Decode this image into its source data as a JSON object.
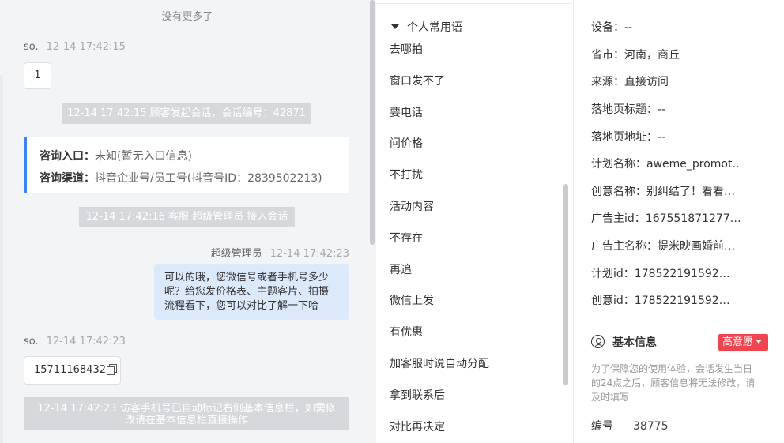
{
  "chat": {
    "no_more": "没有更多了",
    "msg1": {
      "sender": "so.",
      "time": "12-14 17:42:15",
      "text": "1"
    },
    "sys1": "12-14 17:42:15 顾客发起会话，会话编号：42871",
    "card": {
      "entry_label": "咨询入口：",
      "entry_value": "未知(暂无入口信息)",
      "channel_label": "咨询渠道：",
      "channel_value": "抖音企业号/员工号(抖音号ID：2839502213)"
    },
    "sys2": "12-14 17:42:16 客服 超级管理员 接入会话",
    "msg2": {
      "sender": "超级管理员",
      "time": "12-14 17:42:23",
      "line1": "可以的哦，您微信号或者手机号多少",
      "line2": "呢？给您发价格表、主题客片、拍摄",
      "line3": "流程看下，您可以对比了解一下哈"
    },
    "msg3": {
      "sender": "so.",
      "time": "12-14 17:42:23",
      "text": "15711168432",
      "icon": "copy-icon"
    },
    "sys3_line1": "12-14 17:42:23 访客手机号已自动标记右侧基本信息栏，如需修",
    "sys3_line2": "改请在基本信息栏直接操作"
  },
  "phrases": {
    "group_title": "个人常用语",
    "items": [
      "去哪拍",
      "窗口发不了",
      "要电话",
      "问价格",
      "不打扰",
      "活动内容",
      "不存在",
      "再追",
      "微信上发",
      "有优惠",
      "加客服时说自动分配",
      "拿到联系后",
      "对比再决定"
    ]
  },
  "info": {
    "fields": [
      {
        "label": "设备：",
        "value": "--"
      },
      {
        "label": "省市：",
        "value": "河南，商丘"
      },
      {
        "label": "来源：",
        "value": "直接访问"
      },
      {
        "label": "落地页标题：",
        "value": "--"
      },
      {
        "label": "落地页地址：",
        "value": "--"
      },
      {
        "label": "计划名称：",
        "value": "aweme_promot…"
      },
      {
        "label": "创意名称：",
        "value": "别纠结了！看看…"
      },
      {
        "label": "广告主id：",
        "value": "167551871277…"
      },
      {
        "label": "广告主名称：",
        "value": "提米映画婚前…"
      },
      {
        "label": "计划id：",
        "value": "178522191592…"
      },
      {
        "label": "创意id：",
        "value": "178522191592…"
      }
    ],
    "section_title": "基本信息",
    "badge": "高意愿",
    "notice_line1": "为了保障您的使用体验，会话发生当日",
    "notice_line2": "的24点之后，顾客信息将无法修改，请",
    "notice_line3": "及时填写",
    "number_label": "编号",
    "number_value": "38775"
  },
  "colors": {
    "accent_blue": "#3a86f0",
    "badge_red": "#f0454e",
    "agent_bubble": "#dce9fb"
  }
}
